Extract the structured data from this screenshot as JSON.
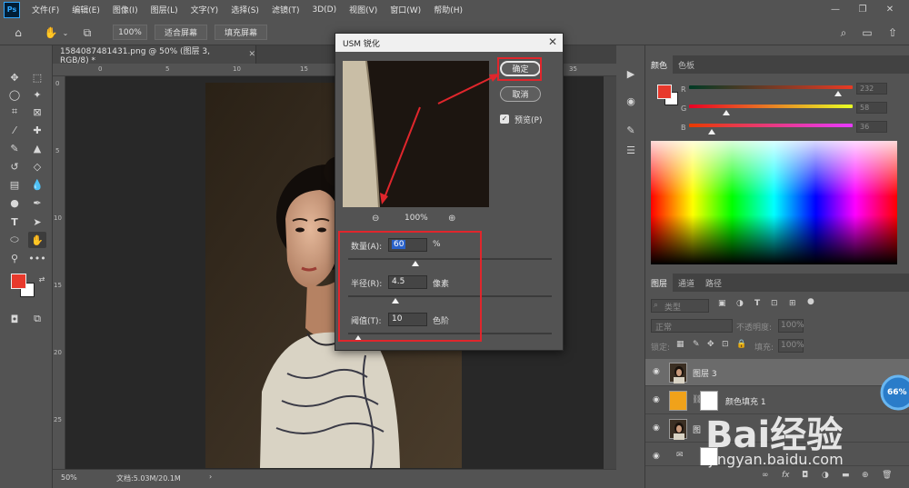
{
  "app": {
    "logo": "Ps",
    "menu": [
      "文件(F)",
      "编辑(E)",
      "图像(I)",
      "图层(L)",
      "文字(Y)",
      "选择(S)",
      "滤镜(T)",
      "3D(D)",
      "视图(V)",
      "窗口(W)",
      "帮助(H)"
    ]
  },
  "options_bar": {
    "zoom_value": "100%",
    "fit_screen": "适合屏幕",
    "fill_screen": "填充屏幕"
  },
  "document": {
    "tab_title": "1584087481431.png @ 50% (图层 3, RGB/8) *",
    "zoom": "50%",
    "doc_info": "文档:5.03M/20.1M"
  },
  "dialog": {
    "title": "USM 锐化",
    "ok_label": "确定",
    "cancel_label": "取消",
    "preview_label": "预览(P)",
    "preview_checked": true,
    "preview_zoom": "100%",
    "amount": {
      "label": "数量(A):",
      "value": "60",
      "unit": "%",
      "level": 0.33
    },
    "radius": {
      "label": "半径(R):",
      "value": "4.5",
      "unit": "像素",
      "level": 0.23
    },
    "threshold": {
      "label": "阈值(T):",
      "value": "10",
      "unit": "色阶",
      "level": 0.05
    }
  },
  "color_panel": {
    "tabs": [
      "颜色",
      "色板"
    ],
    "channels": [
      {
        "label": "R",
        "value": "232",
        "level": 0.91
      },
      {
        "label": "G",
        "value": "58",
        "level": 0.23
      },
      {
        "label": "B",
        "value": "36",
        "level": 0.14
      }
    ],
    "foreground": "#e8392c",
    "background": "#ffffff"
  },
  "layers_panel": {
    "tabs": [
      "图层",
      "通道",
      "路径"
    ],
    "filter_placeholder": "类型",
    "blend_mode": "正常",
    "opacity_label": "不透明度:",
    "opacity_value": "100%",
    "lock_label": "锁定:",
    "fill_label": "填充:",
    "fill_value": "100%",
    "layers": [
      {
        "name": "图层 3",
        "selected": true
      },
      {
        "name": "颜色填充 1",
        "selected": false
      },
      {
        "name": "图",
        "selected": false
      }
    ]
  },
  "badge": {
    "value": "66%"
  },
  "watermark": {
    "text": "Bai经验",
    "url": "jingyan.baidu.com"
  }
}
